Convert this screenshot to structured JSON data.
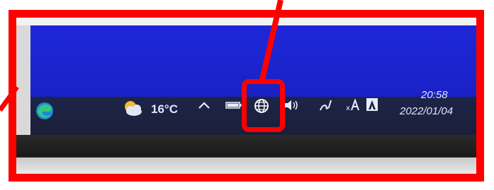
{
  "taskbar": {
    "weather": {
      "temperature": "16°C",
      "icon": "partly-cloudy-icon"
    },
    "tray_icons": [
      "chevron-up-icon",
      "battery-icon",
      "network-globe-icon",
      "speaker-icon",
      "pen-icon",
      "font-a-icon",
      "adobe-icon"
    ],
    "clock": {
      "time": "20:58",
      "date": "2022/01/04"
    },
    "pinned": [
      "edge-icon"
    ]
  },
  "annotation": {
    "highlight_color": "#ff0000",
    "highlighted_icon": "network-globe-icon"
  }
}
